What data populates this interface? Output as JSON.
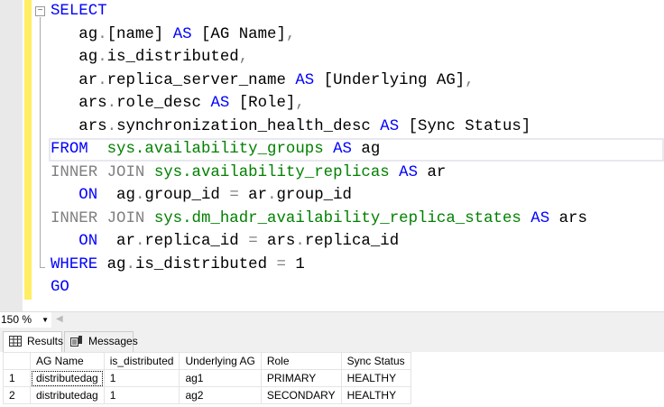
{
  "editor": {
    "lines": [
      [
        [
          "SELECT",
          "kw"
        ]
      ],
      [
        [
          "   ag",
          "tx"
        ],
        [
          ".",
          "op"
        ],
        [
          "[name] ",
          "tx"
        ],
        [
          "AS",
          "kw"
        ],
        [
          " [AG Name]",
          "tx"
        ],
        [
          ",",
          "op"
        ]
      ],
      [
        [
          "   ag",
          "tx"
        ],
        [
          ".",
          "op"
        ],
        [
          "is_distributed",
          "tx"
        ],
        [
          ",",
          "op"
        ]
      ],
      [
        [
          "   ar",
          "tx"
        ],
        [
          ".",
          "op"
        ],
        [
          "replica_server_name ",
          "tx"
        ],
        [
          "AS",
          "kw"
        ],
        [
          " [Underlying AG]",
          "tx"
        ],
        [
          ",",
          "op"
        ]
      ],
      [
        [
          "   ars",
          "tx"
        ],
        [
          ".",
          "op"
        ],
        [
          "role_desc ",
          "tx"
        ],
        [
          "AS",
          "kw"
        ],
        [
          " [Role]",
          "tx"
        ],
        [
          ",",
          "op"
        ]
      ],
      [
        [
          "   ars",
          "tx"
        ],
        [
          ".",
          "op"
        ],
        [
          "synchronization_health_desc ",
          "tx"
        ],
        [
          "AS",
          "kw"
        ],
        [
          " [Sync Status]",
          "tx"
        ]
      ],
      [
        [
          "FROM",
          "kw"
        ],
        [
          "  sys.availability_groups ",
          "sys"
        ],
        [
          "AS",
          "kw"
        ],
        [
          " ag",
          "tx"
        ]
      ],
      [
        [
          "INNER JOIN ",
          "op"
        ],
        [
          "sys.availability_replicas ",
          "sys"
        ],
        [
          "AS",
          "kw"
        ],
        [
          " ar",
          "tx"
        ]
      ],
      [
        [
          "   ON",
          "kw"
        ],
        [
          "  ag",
          "tx"
        ],
        [
          ".",
          "op"
        ],
        [
          "group_id ",
          "tx"
        ],
        [
          "=",
          "op"
        ],
        [
          " ar",
          "tx"
        ],
        [
          ".",
          "op"
        ],
        [
          "group_id",
          "tx"
        ]
      ],
      [
        [
          "INNER JOIN ",
          "op"
        ],
        [
          "sys.dm_hadr_availability_replica_states ",
          "sys"
        ],
        [
          "AS",
          "kw"
        ],
        [
          " ars",
          "tx"
        ]
      ],
      [
        [
          "   ON",
          "kw"
        ],
        [
          "  ar",
          "tx"
        ],
        [
          ".",
          "op"
        ],
        [
          "replica_id ",
          "tx"
        ],
        [
          "=",
          "op"
        ],
        [
          " ars",
          "tx"
        ],
        [
          ".",
          "op"
        ],
        [
          "replica_id",
          "tx"
        ]
      ],
      [
        [
          "WHERE",
          "kw"
        ],
        [
          " ag",
          "tx"
        ],
        [
          ".",
          "op"
        ],
        [
          "is_distributed ",
          "tx"
        ],
        [
          "=",
          "op"
        ],
        [
          " 1",
          "tx"
        ]
      ],
      [
        [
          "GO",
          "kw"
        ]
      ]
    ]
  },
  "zoom": {
    "value": "150 %"
  },
  "tabs": {
    "results": "Results",
    "messages": "Messages"
  },
  "grid": {
    "headers": [
      "",
      "AG Name",
      "is_distributed",
      "Underlying AG",
      "Role",
      "Sync Status"
    ],
    "rows": [
      [
        "1",
        "distributedag",
        "1",
        "ag1",
        "PRIMARY",
        "HEALTHY"
      ],
      [
        "2",
        "distributedag",
        "1",
        "ag2",
        "SECONDARY",
        "HEALTHY"
      ]
    ]
  }
}
